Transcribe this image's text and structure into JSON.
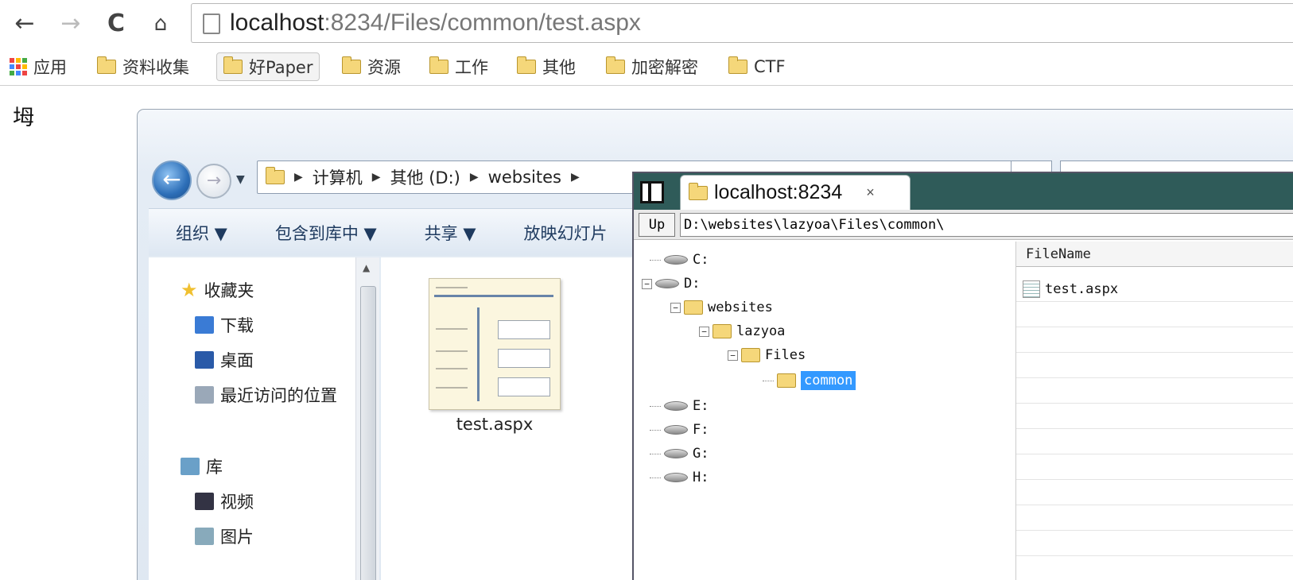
{
  "browser": {
    "url_host": "localhost",
    "url_path": ":8234/Files/common/test.aspx",
    "nav_icons": [
      "back-icon",
      "forward-icon",
      "reload-icon",
      "home-icon",
      "page-icon"
    ],
    "bookmarks": [
      {
        "label": "应用",
        "type": "apps"
      },
      {
        "label": "资料收集",
        "type": "folder"
      },
      {
        "label": "好Paper",
        "type": "folder",
        "active": true
      },
      {
        "label": "资源",
        "type": "folder"
      },
      {
        "label": "工作",
        "type": "folder"
      },
      {
        "label": "其他",
        "type": "folder"
      },
      {
        "label": "加密解密",
        "type": "folder"
      },
      {
        "label": "CTF",
        "type": "folder"
      }
    ]
  },
  "page": {
    "garbled_text": "坶"
  },
  "explorer": {
    "crumbs": [
      "计算机",
      "其他 (D:)",
      "websites"
    ],
    "commands": [
      "组织 ▼",
      "包含到库中 ▼",
      "共享 ▼",
      "放映幻灯片"
    ],
    "nav_items": [
      {
        "label": "收藏夹",
        "icon": "star-icon",
        "color": "#f0c030"
      },
      {
        "label": "下载",
        "icon": "download-folder-icon",
        "color": "#3a7bd5"
      },
      {
        "label": "桌面",
        "icon": "desktop-icon",
        "color": "#2a5aa8"
      },
      {
        "label": "最近访问的位置",
        "icon": "recent-places-icon",
        "color": "#9aa8b8"
      },
      {
        "label": "库",
        "icon": "library-icon",
        "color": "#6aa0c8"
      },
      {
        "label": "视频",
        "icon": "video-icon",
        "color": "#334"
      },
      {
        "label": "图片",
        "icon": "pictures-icon",
        "color": "#8ab"
      }
    ],
    "file_name": "test.aspx"
  },
  "webshell": {
    "tab_title": "localhost:8234",
    "tab_close": "×",
    "up_label": "Up",
    "path": "D:\\websites\\lazyoa\\Files\\common\\",
    "tree": [
      {
        "label": "C:",
        "kind": "drive",
        "depth": 0
      },
      {
        "label": "D:",
        "kind": "drive",
        "depth": 0,
        "expanded": true
      },
      {
        "label": "websites",
        "kind": "folder",
        "depth": 1,
        "expanded": true
      },
      {
        "label": "lazyoa",
        "kind": "folder",
        "depth": 2,
        "expanded": true
      },
      {
        "label": "Files",
        "kind": "folder",
        "depth": 3,
        "expanded": true
      },
      {
        "label": "common",
        "kind": "folder",
        "depth": 4,
        "selected": true
      },
      {
        "label": "E:",
        "kind": "drive",
        "depth": 0
      },
      {
        "label": "F:",
        "kind": "drive",
        "depth": 0
      },
      {
        "label": "G:",
        "kind": "drive",
        "depth": 0
      },
      {
        "label": "H:",
        "kind": "drive",
        "depth": 0
      }
    ],
    "grid_header": "FileName",
    "files": [
      "test.aspx"
    ]
  }
}
